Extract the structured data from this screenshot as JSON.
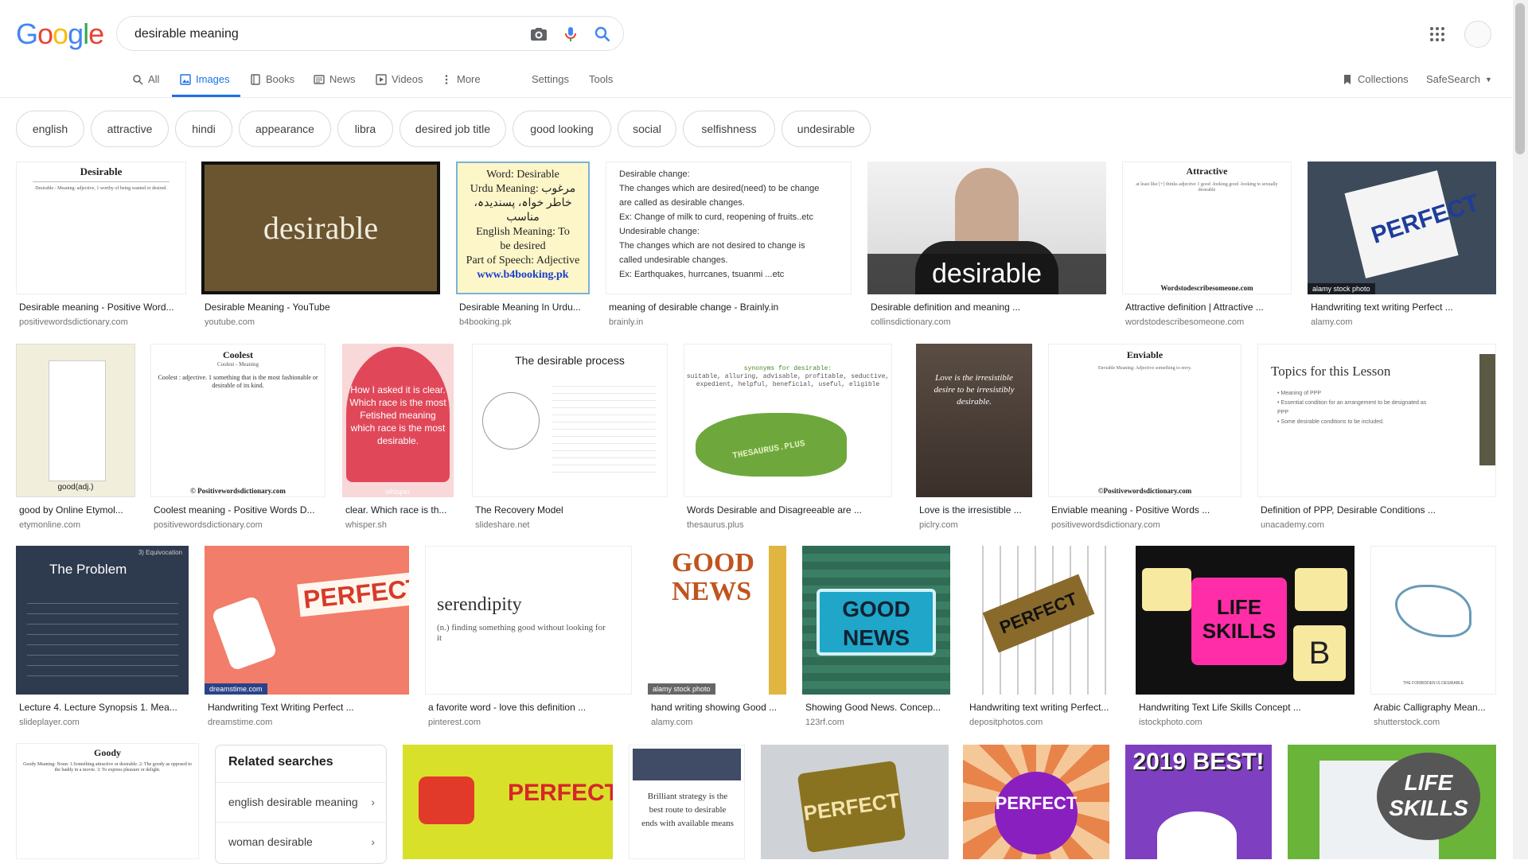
{
  "search": {
    "query": "desirable meaning"
  },
  "tabs": [
    {
      "label": "All",
      "icon": "search-icon"
    },
    {
      "label": "Images",
      "icon": "image-icon"
    },
    {
      "label": "Books",
      "icon": "book-icon"
    },
    {
      "label": "News",
      "icon": "news-icon"
    },
    {
      "label": "Videos",
      "icon": "video-icon"
    },
    {
      "label": "More",
      "icon": "more-vert-icon"
    }
  ],
  "tools": {
    "settings": "Settings",
    "tools": "Tools",
    "collections": "Collections",
    "safesearch": "SafeSearch"
  },
  "chips": [
    "english",
    "attractive",
    "hindi",
    "appearance",
    "libra",
    "desired job title",
    "good looking",
    "social",
    "selfishness",
    "undesirable"
  ],
  "row1": [
    {
      "title": "Desirable meaning - Positive Word...",
      "source": "positivewordsdictionary.com",
      "img_text": "Desirable"
    },
    {
      "title": "Desirable Meaning - YouTube",
      "source": "youtube.com",
      "img_text": "desirable"
    },
    {
      "title": "Desirable Meaning In Urdu...",
      "source": "b4booking.pk",
      "img_lines": [
        "Word: Desirable",
        "Urdu Meaning: مرغوب",
        "خاطر خواہ، پسندیدہ، مناسب",
        "English Meaning: To",
        "be desired",
        "Part of Speech: Adjective",
        "www.b4booking.pk"
      ]
    },
    {
      "title": "meaning of desirable change - Brainly.in",
      "source": "brainly.in",
      "img_lines": [
        "Desirable change:",
        "The changes which are desired(need) to be change",
        "are called as desirable changes.",
        "Ex: Change of milk to curd, reopening of fruits..etc",
        "Undesirable change:",
        "The changes which are not desired to change is",
        "called undesirable changes.",
        "Ex: Earthquakes, hurrcanes, tsuanmi ...etc"
      ]
    },
    {
      "title": "Desirable definition and meaning ...",
      "source": "collinsdictionary.com",
      "img_text": "desirable"
    },
    {
      "title": "Attractive definition | Attractive ...",
      "source": "wordstodescribesomeone.com",
      "img_text": "Attractive",
      "img_footer": "Wordstodescribesomeone.com"
    },
    {
      "title": "Handwriting text writing Perfect ...",
      "source": "alamy.com",
      "img_text": "PERFECT",
      "img_footer": "alamy stock photo"
    }
  ],
  "row2": [
    {
      "title": "good by Online Etymol...",
      "source": "etymonline.com",
      "img_text": "good(adj.)"
    },
    {
      "title": "Coolest meaning - Positive Words D...",
      "source": "positivewordsdictionary.com",
      "img_text": "Coolest",
      "img_sub": "Coolest - Meaning",
      "img_footer": "© Positivewordsdictionary.com"
    },
    {
      "title": "clear. Which race is th...",
      "source": "whisper.sh",
      "img_lines": [
        "How I asked it is clear.",
        "Which race is the most",
        "Fetished meaning",
        "which race is the most",
        "desirable."
      ],
      "img_footer": "whisper"
    },
    {
      "title": "The Recovery Model",
      "source": "slideshare.net",
      "img_text": "The desirable process"
    },
    {
      "title": "Words Desirable and Disagreeable are ...",
      "source": "thesaurus.plus",
      "img_lines": [
        "synonyms for desirable:",
        "suitable, alluring, advisable, profitable, seductive,",
        "expedient, helpful, beneficial, useful, eligible"
      ],
      "img_footer": "THESAURUS.PLUS"
    },
    {
      "title": "Love is the irresistible ...",
      "source": "piclry.com",
      "img_lines": [
        "Love is the irresistible",
        "desire to be irresistibly",
        "desirable."
      ]
    },
    {
      "title": "Enviable meaning - Positive Words ...",
      "source": "positivewordsdictionary.com",
      "img_text": "Enviable",
      "img_footer": "©Positivewordsdictionary.com"
    },
    {
      "title": "Definition of PPP, Desirable Conditions ...",
      "source": "unacademy.com",
      "img_text": "Topics for this Lesson"
    }
  ],
  "row3": [
    {
      "title": "Lecture 4. Lecture Synopsis 1. Mea...",
      "source": "slideplayer.com",
      "img_text": "The Problem",
      "img_sub": "3) Equivocation"
    },
    {
      "title": "Handwriting Text Writing Perfect ...",
      "source": "dreamstime.com",
      "img_text": "PERFECT",
      "img_footer": "dreamstime.com"
    },
    {
      "title": "a favorite word - love this definition ...",
      "source": "pinterest.com",
      "img_text": "serendipity",
      "img_sub": "(n.) finding something good without looking for it"
    },
    {
      "title": "hand writing showing Good ...",
      "source": "alamy.com",
      "img_text": "GOOD NEWS",
      "img_footer": "alamy stock photo"
    },
    {
      "title": "Showing Good News. Concep...",
      "source": "123rf.com",
      "img_text": "GOOD NEWS"
    },
    {
      "title": "Handwriting text writing Perfect...",
      "source": "depositphotos.com",
      "img_text": "PERFECT"
    },
    {
      "title": "Handwriting Text Life Skills Concept ...",
      "source": "istockphoto.com",
      "img_text": "LIFE SKILLS"
    },
    {
      "title": "Arabic Calligraphy Mean...",
      "source": "shutterstock.com",
      "img_footer": "THE FORBIDDEN IS DESIRABLE"
    }
  ],
  "row4": [
    {
      "img_text": "Goody",
      "img_sub": "Goody Meaning: Noun: 1.Something attractive or desirable. 2: The goody as opposed to the baddy in a movie. 3: To express pleasure or delight."
    },
    {
      "img_text": "PERFECT"
    },
    {
      "img_lines": [
        "Brilliant strategy is the",
        "best route to desirable",
        "ends with available means"
      ]
    },
    {
      "img_text": "PERFECT"
    },
    {
      "img_text": "PERFECT"
    },
    {
      "img_text": "2019 BEST!"
    },
    {
      "img_text": "LIFE SKILLS"
    }
  ],
  "related": {
    "heading": "Related searches",
    "items": [
      "english desirable meaning",
      "woman desirable"
    ]
  },
  "colors": {
    "accent": "#1a73e8",
    "muted": "#70757a"
  }
}
